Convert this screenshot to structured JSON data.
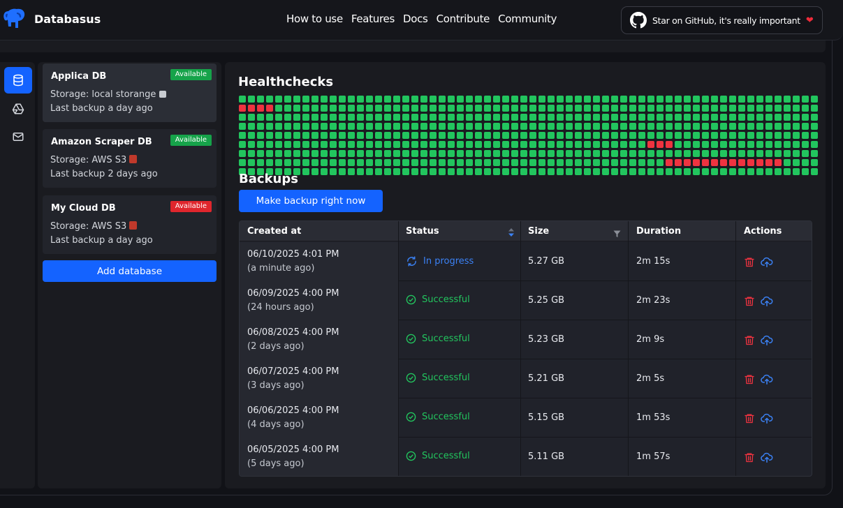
{
  "nav": {
    "brand": "Databasus",
    "links": [
      "How to use",
      "Features",
      "Docs",
      "Contribute",
      "Community"
    ],
    "github_label": "Star on GitHub, it's really important"
  },
  "databases": [
    {
      "name": "Applica DB",
      "status": "Available",
      "status_color": "#16a34a",
      "storage": "Storage: local storange",
      "storage_icon": "hard-drive-icon",
      "last_backup": "Last backup a day ago",
      "selected": true
    },
    {
      "name": "Amazon Scraper DB",
      "status": "Available",
      "status_color": "#16a34a",
      "storage": "Storage: AWS S3",
      "storage_icon": "aws-s3-icon",
      "last_backup": "Last backup 2 days ago",
      "selected": false
    },
    {
      "name": "My Cloud DB",
      "status": "Available",
      "status_color": "#e0262d",
      "storage": "Storage: AWS S3",
      "storage_icon": "aws-s3-icon",
      "last_backup": "Last backup a day ago",
      "selected": false
    }
  ],
  "add_database_label": "Add database",
  "healthchecks": {
    "title": "Healthchecks",
    "ok_color": "#22c55e",
    "fail_color": "#ef3340",
    "rows": [
      "gggggggggggggggggggggggggggggggggggggggggggggggggggggggggggggggg",
      "rrrrgggggggggggggggggggggggggggggggggggggggggggggggggggggggggggg",
      "gggggggggggggggggggggggggggggggggggggggggggggggggggggggggggggggg",
      "gggggggggggggggggggggggggggggggggggggggggggggggggggggggggggggggg",
      "gggggggggggggggggggggggggggggggggggggggggggggggggggggggggggggggg",
      "gggggggggggggggggggggggggggggggggggggggggggggrrrgggggggggggggggg",
      "gggggggggggggggggggggggggggggggggggggggggggggggggggggggggggggggg",
      "gggggggggggggggggggggggggggggggggggggggggggggggrrrrrrrrrrrrrgggg",
      "gggggggggggggggggggggggggggggggggggggggggggggggggggggggggggggggg"
    ]
  },
  "backups": {
    "title": "Backups",
    "make_backup_label": "Make backup right now",
    "columns": [
      "Created at",
      "Status",
      "Size",
      "Duration",
      "Actions"
    ],
    "rows": [
      {
        "created": "06/10/2025 4:01 PM",
        "ago": "(a minute ago)",
        "status": "In progress",
        "state": "progress",
        "size": "5.27 GB",
        "duration": "2m 15s"
      },
      {
        "created": "06/09/2025 4:00 PM",
        "ago": "(24 hours ago)",
        "status": "Successful",
        "state": "ok",
        "size": "5.25 GB",
        "duration": "2m 23s"
      },
      {
        "created": "06/08/2025 4:00 PM",
        "ago": "(2 days ago)",
        "status": "Successful",
        "state": "ok",
        "size": "5.23 GB",
        "duration": "2m 9s"
      },
      {
        "created": "06/07/2025 4:00 PM",
        "ago": "(3 days ago)",
        "status": "Successful",
        "state": "ok",
        "size": "5.21 GB",
        "duration": "2m 5s"
      },
      {
        "created": "06/06/2025 4:00 PM",
        "ago": "(4 days ago)",
        "status": "Successful",
        "state": "ok",
        "size": "5.15 GB",
        "duration": "1m 53s"
      },
      {
        "created": "06/05/2025 4:00 PM",
        "ago": "(5 days ago)",
        "status": "Successful",
        "state": "ok",
        "size": "5.11 GB",
        "duration": "1m 57s"
      }
    ]
  }
}
